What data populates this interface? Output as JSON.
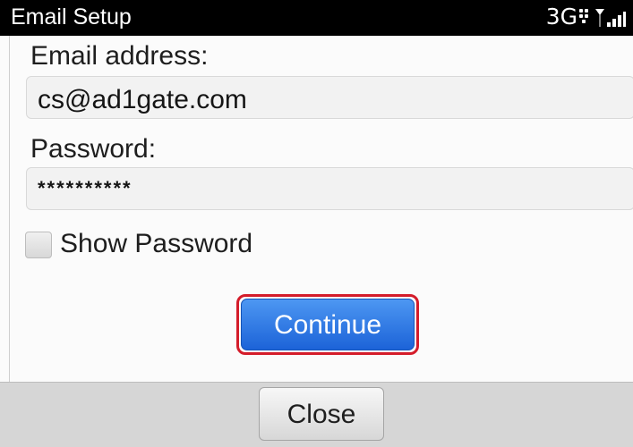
{
  "status_bar": {
    "title": "Email Setup",
    "network": "3G",
    "icons": [
      "blackberry-icon",
      "signal-icon"
    ]
  },
  "form": {
    "email_label": "Email address:",
    "email_value": "cs@ad1gate.com",
    "password_label": "Password:",
    "password_value": "**********",
    "show_password_label": "Show Password",
    "show_password_checked": false,
    "continue_label": "Continue"
  },
  "footer": {
    "close_label": "Close"
  },
  "colors": {
    "accent_blue": "#1c63d8",
    "highlight_red": "#d41c2a"
  }
}
